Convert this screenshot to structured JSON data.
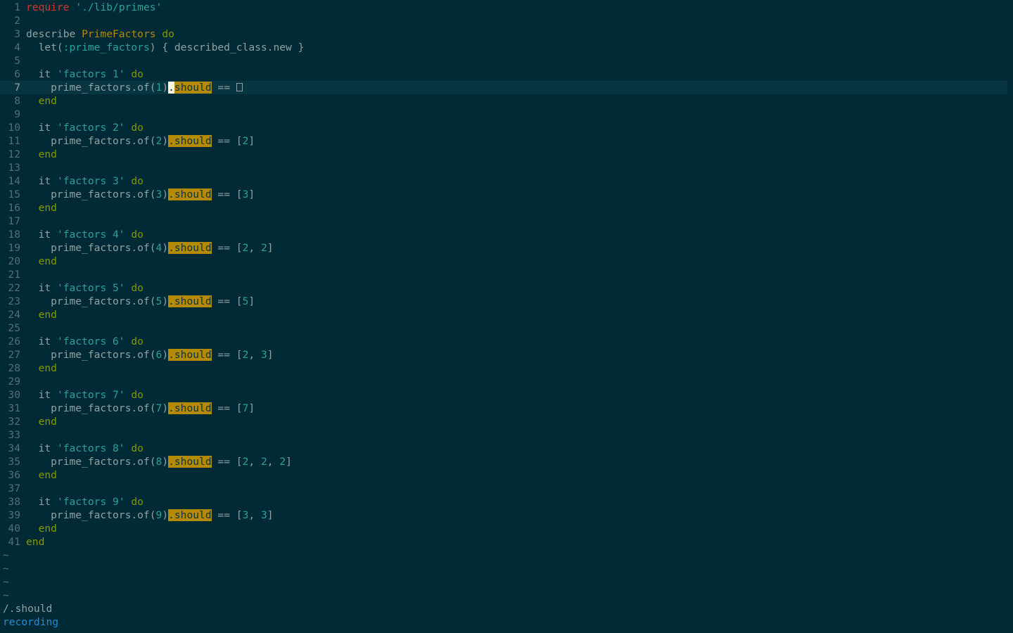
{
  "editor": {
    "cursor_line": 7,
    "lines": [
      {
        "n": "1",
        "tokens": [
          {
            "t": "require",
            "c": "kw-req"
          },
          {
            "t": " ",
            "c": "ident"
          },
          {
            "t": "'./lib/primes'",
            "c": "str"
          }
        ]
      },
      {
        "n": "2",
        "tokens": []
      },
      {
        "n": "3",
        "tokens": [
          {
            "t": "describe ",
            "c": "ident"
          },
          {
            "t": "PrimeFactors",
            "c": "const"
          },
          {
            "t": " ",
            "c": "ident"
          },
          {
            "t": "do",
            "c": "kw"
          }
        ]
      },
      {
        "n": "4",
        "tokens": [
          {
            "t": "  let(",
            "c": "ident"
          },
          {
            "t": ":prime_factors",
            "c": "sym"
          },
          {
            "t": ") { described_class.new }",
            "c": "ident"
          }
        ]
      },
      {
        "n": "5",
        "tokens": []
      },
      {
        "n": "6",
        "tokens": [
          {
            "t": "  it ",
            "c": "ident"
          },
          {
            "t": "'factors 1'",
            "c": "str"
          },
          {
            "t": " ",
            "c": "ident"
          },
          {
            "t": "do",
            "c": "kw"
          }
        ]
      },
      {
        "n": "7",
        "tokens": [
          {
            "t": "    prime_factors.of(",
            "c": "ident"
          },
          {
            "t": "1",
            "c": "numlit"
          },
          {
            "t": ")",
            "c": "ident"
          },
          {
            "t": ".",
            "c": "cursor"
          },
          {
            "t": "should",
            "c": "search-hl"
          },
          {
            "t": " == ",
            "c": "ident"
          },
          {
            "t": "",
            "c": "empty-box"
          }
        ]
      },
      {
        "n": "8",
        "tokens": [
          {
            "t": "  end",
            "c": "kw"
          }
        ]
      },
      {
        "n": "9",
        "tokens": []
      },
      {
        "n": "10",
        "tokens": [
          {
            "t": "  it ",
            "c": "ident"
          },
          {
            "t": "'factors 2'",
            "c": "str"
          },
          {
            "t": " ",
            "c": "ident"
          },
          {
            "t": "do",
            "c": "kw"
          }
        ]
      },
      {
        "n": "11",
        "tokens": [
          {
            "t": "    prime_factors.of(",
            "c": "ident"
          },
          {
            "t": "2",
            "c": "numlit"
          },
          {
            "t": ")",
            "c": "ident"
          },
          {
            "t": ".should",
            "c": "search-hl"
          },
          {
            "t": " == [",
            "c": "ident"
          },
          {
            "t": "2",
            "c": "numlit"
          },
          {
            "t": "]",
            "c": "ident"
          }
        ]
      },
      {
        "n": "12",
        "tokens": [
          {
            "t": "  end",
            "c": "kw"
          }
        ]
      },
      {
        "n": "13",
        "tokens": []
      },
      {
        "n": "14",
        "tokens": [
          {
            "t": "  it ",
            "c": "ident"
          },
          {
            "t": "'factors 3'",
            "c": "str"
          },
          {
            "t": " ",
            "c": "ident"
          },
          {
            "t": "do",
            "c": "kw"
          }
        ]
      },
      {
        "n": "15",
        "tokens": [
          {
            "t": "    prime_factors.of(",
            "c": "ident"
          },
          {
            "t": "3",
            "c": "numlit"
          },
          {
            "t": ")",
            "c": "ident"
          },
          {
            "t": ".should",
            "c": "search-hl"
          },
          {
            "t": " == [",
            "c": "ident"
          },
          {
            "t": "3",
            "c": "numlit"
          },
          {
            "t": "]",
            "c": "ident"
          }
        ]
      },
      {
        "n": "16",
        "tokens": [
          {
            "t": "  end",
            "c": "kw"
          }
        ]
      },
      {
        "n": "17",
        "tokens": []
      },
      {
        "n": "18",
        "tokens": [
          {
            "t": "  it ",
            "c": "ident"
          },
          {
            "t": "'factors 4'",
            "c": "str"
          },
          {
            "t": " ",
            "c": "ident"
          },
          {
            "t": "do",
            "c": "kw"
          }
        ]
      },
      {
        "n": "19",
        "tokens": [
          {
            "t": "    prime_factors.of(",
            "c": "ident"
          },
          {
            "t": "4",
            "c": "numlit"
          },
          {
            "t": ")",
            "c": "ident"
          },
          {
            "t": ".should",
            "c": "search-hl"
          },
          {
            "t": " == [",
            "c": "ident"
          },
          {
            "t": "2",
            "c": "numlit"
          },
          {
            "t": ", ",
            "c": "ident"
          },
          {
            "t": "2",
            "c": "numlit"
          },
          {
            "t": "]",
            "c": "ident"
          }
        ]
      },
      {
        "n": "20",
        "tokens": [
          {
            "t": "  end",
            "c": "kw"
          }
        ]
      },
      {
        "n": "21",
        "tokens": []
      },
      {
        "n": "22",
        "tokens": [
          {
            "t": "  it ",
            "c": "ident"
          },
          {
            "t": "'factors 5'",
            "c": "str"
          },
          {
            "t": " ",
            "c": "ident"
          },
          {
            "t": "do",
            "c": "kw"
          }
        ]
      },
      {
        "n": "23",
        "tokens": [
          {
            "t": "    prime_factors.of(",
            "c": "ident"
          },
          {
            "t": "5",
            "c": "numlit"
          },
          {
            "t": ")",
            "c": "ident"
          },
          {
            "t": ".should",
            "c": "search-hl"
          },
          {
            "t": " == [",
            "c": "ident"
          },
          {
            "t": "5",
            "c": "numlit"
          },
          {
            "t": "]",
            "c": "ident"
          }
        ]
      },
      {
        "n": "24",
        "tokens": [
          {
            "t": "  end",
            "c": "kw"
          }
        ]
      },
      {
        "n": "25",
        "tokens": []
      },
      {
        "n": "26",
        "tokens": [
          {
            "t": "  it ",
            "c": "ident"
          },
          {
            "t": "'factors 6'",
            "c": "str"
          },
          {
            "t": " ",
            "c": "ident"
          },
          {
            "t": "do",
            "c": "kw"
          }
        ]
      },
      {
        "n": "27",
        "tokens": [
          {
            "t": "    prime_factors.of(",
            "c": "ident"
          },
          {
            "t": "6",
            "c": "numlit"
          },
          {
            "t": ")",
            "c": "ident"
          },
          {
            "t": ".should",
            "c": "search-hl"
          },
          {
            "t": " == [",
            "c": "ident"
          },
          {
            "t": "2",
            "c": "numlit"
          },
          {
            "t": ", ",
            "c": "ident"
          },
          {
            "t": "3",
            "c": "numlit"
          },
          {
            "t": "]",
            "c": "ident"
          }
        ]
      },
      {
        "n": "28",
        "tokens": [
          {
            "t": "  end",
            "c": "kw"
          }
        ]
      },
      {
        "n": "29",
        "tokens": []
      },
      {
        "n": "30",
        "tokens": [
          {
            "t": "  it ",
            "c": "ident"
          },
          {
            "t": "'factors 7'",
            "c": "str"
          },
          {
            "t": " ",
            "c": "ident"
          },
          {
            "t": "do",
            "c": "kw"
          }
        ]
      },
      {
        "n": "31",
        "tokens": [
          {
            "t": "    prime_factors.of(",
            "c": "ident"
          },
          {
            "t": "7",
            "c": "numlit"
          },
          {
            "t": ")",
            "c": "ident"
          },
          {
            "t": ".should",
            "c": "search-hl"
          },
          {
            "t": " == [",
            "c": "ident"
          },
          {
            "t": "7",
            "c": "numlit"
          },
          {
            "t": "]",
            "c": "ident"
          }
        ]
      },
      {
        "n": "32",
        "tokens": [
          {
            "t": "  end",
            "c": "kw"
          }
        ]
      },
      {
        "n": "33",
        "tokens": []
      },
      {
        "n": "34",
        "tokens": [
          {
            "t": "  it ",
            "c": "ident"
          },
          {
            "t": "'factors 8'",
            "c": "str"
          },
          {
            "t": " ",
            "c": "ident"
          },
          {
            "t": "do",
            "c": "kw"
          }
        ]
      },
      {
        "n": "35",
        "tokens": [
          {
            "t": "    prime_factors.of(",
            "c": "ident"
          },
          {
            "t": "8",
            "c": "numlit"
          },
          {
            "t": ")",
            "c": "ident"
          },
          {
            "t": ".should",
            "c": "search-hl"
          },
          {
            "t": " == [",
            "c": "ident"
          },
          {
            "t": "2",
            "c": "numlit"
          },
          {
            "t": ", ",
            "c": "ident"
          },
          {
            "t": "2",
            "c": "numlit"
          },
          {
            "t": ", ",
            "c": "ident"
          },
          {
            "t": "2",
            "c": "numlit"
          },
          {
            "t": "]",
            "c": "ident"
          }
        ]
      },
      {
        "n": "36",
        "tokens": [
          {
            "t": "  end",
            "c": "kw"
          }
        ]
      },
      {
        "n": "37",
        "tokens": []
      },
      {
        "n": "38",
        "tokens": [
          {
            "t": "  it ",
            "c": "ident"
          },
          {
            "t": "'factors 9'",
            "c": "str"
          },
          {
            "t": " ",
            "c": "ident"
          },
          {
            "t": "do",
            "c": "kw"
          }
        ]
      },
      {
        "n": "39",
        "tokens": [
          {
            "t": "    prime_factors.of(",
            "c": "ident"
          },
          {
            "t": "9",
            "c": "numlit"
          },
          {
            "t": ")",
            "c": "ident"
          },
          {
            "t": ".should",
            "c": "search-hl"
          },
          {
            "t": " == [",
            "c": "ident"
          },
          {
            "t": "3",
            "c": "numlit"
          },
          {
            "t": ", ",
            "c": "ident"
          },
          {
            "t": "3",
            "c": "numlit"
          },
          {
            "t": "]",
            "c": "ident"
          }
        ]
      },
      {
        "n": "40",
        "tokens": [
          {
            "t": "  end",
            "c": "kw"
          }
        ]
      },
      {
        "n": "41",
        "tokens": [
          {
            "t": "end",
            "c": "kw"
          }
        ]
      }
    ],
    "tildes": [
      "~",
      "~",
      "~",
      "~"
    ]
  },
  "cmdline": {
    "search_text": "/.should"
  },
  "status": {
    "message": "recording"
  },
  "colors": {
    "background": "#002b36",
    "cursorline": "#073642",
    "line_number": "#586e75",
    "keyword": "#859900",
    "require": "#dc322f",
    "string": "#2aa198",
    "constant": "#b58900",
    "search_highlight": "#b58900",
    "status_message": "#268bd2"
  }
}
